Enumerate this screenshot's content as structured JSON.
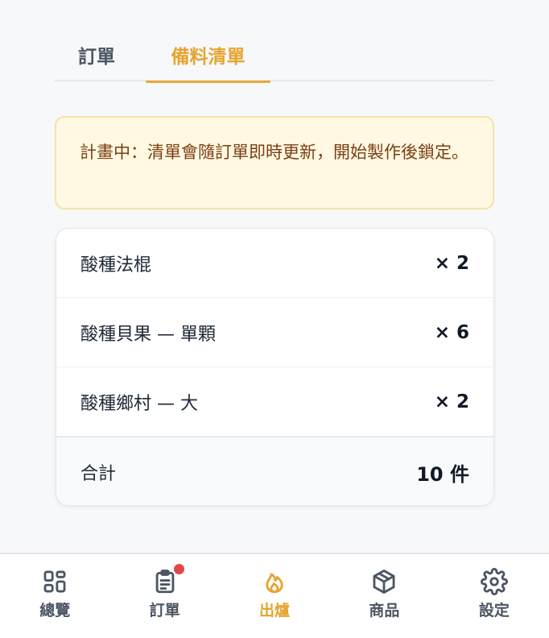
{
  "tabs": [
    {
      "label": "訂單",
      "active": false
    },
    {
      "label": "備料清單",
      "active": true
    }
  ],
  "notice": {
    "text": "計畫中：清單會隨訂單即時更新，開始製作後鎖定。"
  },
  "items": [
    {
      "name": "酸種法棍",
      "qty": "× 2"
    },
    {
      "name": "酸種貝果 — 單顆",
      "qty": "× 6"
    },
    {
      "name": "酸種鄉村 — 大",
      "qty": "× 2"
    }
  ],
  "total": {
    "label": "合計",
    "value": "10 件"
  },
  "nav": [
    {
      "label": "總覽",
      "icon": "grid-icon",
      "active": false
    },
    {
      "label": "訂單",
      "icon": "clipboard-icon",
      "active": false,
      "badge": true
    },
    {
      "label": "出爐",
      "icon": "flame-icon",
      "active": true
    },
    {
      "label": "商品",
      "icon": "box-icon",
      "active": false
    },
    {
      "label": "設定",
      "icon": "gear-icon",
      "active": false
    }
  ],
  "colors": {
    "accent": "#e8a93a",
    "notice_bg": "#fff8e3",
    "notice_text": "#7a3f12",
    "badge": "#e04848"
  }
}
